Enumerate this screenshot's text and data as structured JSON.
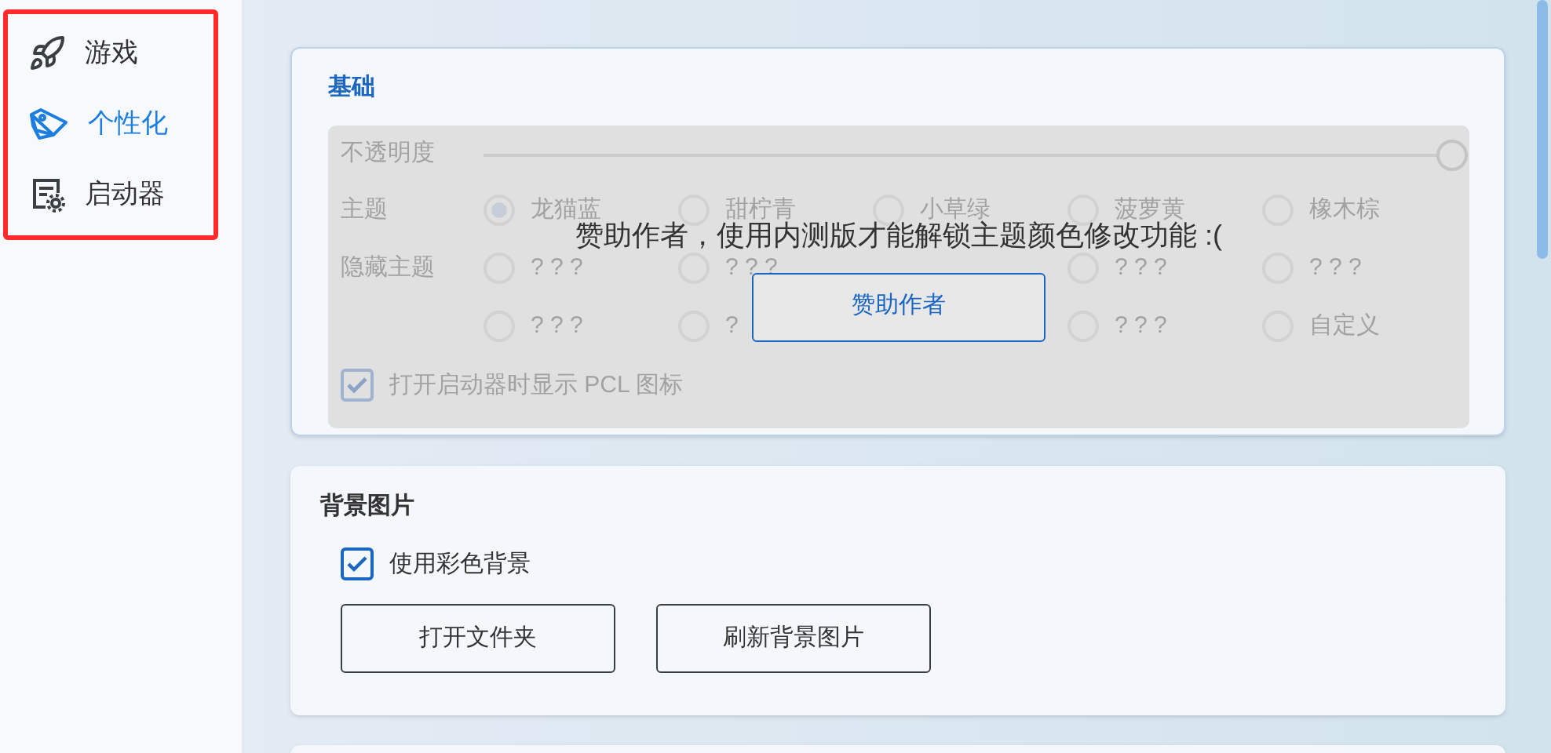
{
  "sidebar": {
    "items": [
      {
        "label": "游戏",
        "selected": false
      },
      {
        "label": "个性化",
        "selected": true
      },
      {
        "label": "启动器",
        "selected": false
      }
    ]
  },
  "basics": {
    "title": "基础",
    "opacity": {
      "label": "不透明度",
      "level": 1
    },
    "theme": {
      "label": "主题",
      "options": [
        {
          "label": "龙猫蓝",
          "selected": true
        },
        {
          "label": "甜柠青",
          "selected": false
        },
        {
          "label": "小草绿",
          "selected": false
        },
        {
          "label": "菠萝黄",
          "selected": false
        },
        {
          "label": "橡木棕",
          "selected": false
        }
      ]
    },
    "hidden_themes": {
      "label": "隐藏主题",
      "options": [
        {
          "kind": "radio",
          "label": "? ? ?",
          "selected": false
        },
        {
          "kind": "radio",
          "label": "? ? ?",
          "selected": false
        },
        {
          "kind": "covered"
        },
        {
          "kind": "radio",
          "label": "? ? ?",
          "selected": false
        },
        {
          "kind": "radio",
          "label": "? ? ?",
          "selected": false
        },
        {
          "kind": "radio",
          "label": "? ? ?",
          "selected": false
        },
        {
          "kind": "radio",
          "label": "?",
          "selected": false
        },
        {
          "kind": "covered"
        },
        {
          "kind": "radio",
          "label": "? ? ?",
          "selected": false
        },
        {
          "kind": "radio",
          "label": "自定义",
          "selected": false
        }
      ]
    },
    "show_icon": {
      "label": "打开启动器时显示 PCL 图标",
      "checked": true
    },
    "lock_message": "赞助作者，使用内测版才能解锁主题颜色修改功能 :(",
    "lock_button": "赞助作者"
  },
  "background": {
    "title": "背景图片",
    "colored": {
      "label": "使用彩色背景",
      "checked": true
    },
    "buttons": [
      "打开文件夹",
      "刷新背景图片"
    ]
  }
}
